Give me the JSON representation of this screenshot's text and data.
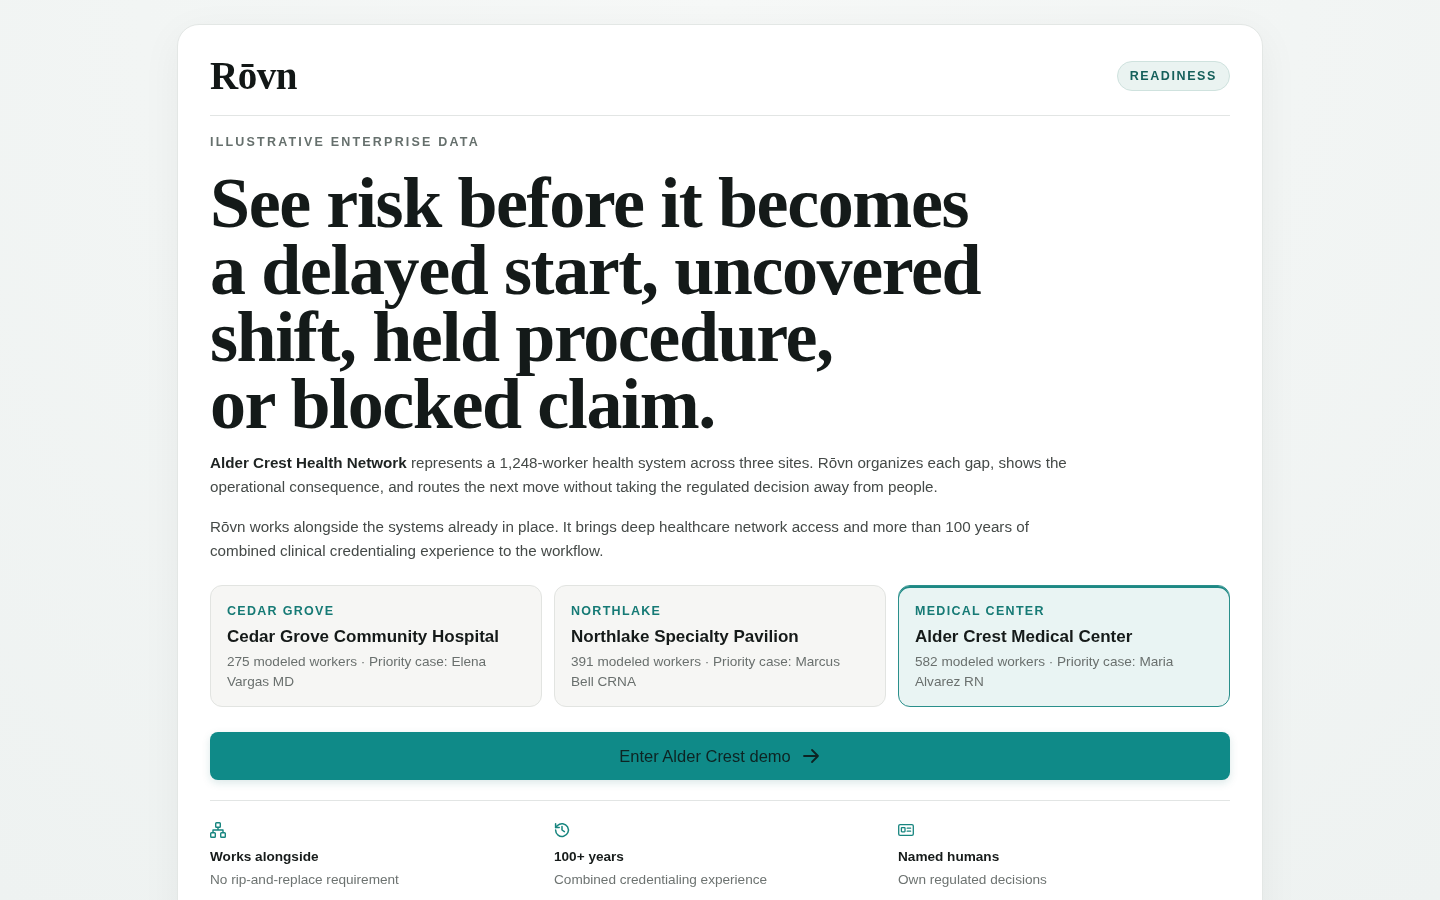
{
  "header": {
    "logo": "Rōvn",
    "badge": "READINESS"
  },
  "eyebrow": "ILLUSTRATIVE ENTERPRISE DATA",
  "headline": "See risk before it becomes\na delayed start, uncovered\nshift, held procedure,\nor blocked claim.",
  "intro": [
    "**Alder Crest Health Network** represents a 1,248-worker health system across three sites. Rōvn organizes each gap, shows the operational consequence, and routes the next move without taking the regulated decision away from people.",
    "Rōvn works alongside the systems already in place. It brings deep healthcare network access and more than 100 years of combined clinical credentialing experience to the workflow."
  ],
  "sites": [
    {
      "region": "CEDAR GROVE",
      "name": "Cedar Grove Community Hospital",
      "detail": "275 modeled workers · Priority case: Elena Vargas MD",
      "selected": false
    },
    {
      "region": "NORTHLAKE",
      "name": "Northlake Specialty Pavilion",
      "detail": "391 modeled workers · Priority case: Marcus Bell CRNA",
      "selected": false
    },
    {
      "region": "MEDICAL CENTER",
      "name": "Alder Crest Medical Center",
      "detail": "582 modeled workers · Priority case: Maria Alvarez RN",
      "selected": true
    }
  ],
  "cta": {
    "label": "Enter Alder Crest demo"
  },
  "features": [
    {
      "kind": "network",
      "title": "Works alongside",
      "subtitle": "No rip-and-replace requirement"
    },
    {
      "kind": "history",
      "title": "100+ years",
      "subtitle": "Combined credentialing experience"
    },
    {
      "kind": "id-card",
      "title": "Named humans",
      "subtitle": "Own regulated decisions"
    }
  ]
}
